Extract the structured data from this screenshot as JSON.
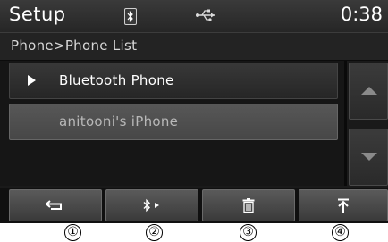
{
  "status": {
    "title": "Setup",
    "clock": "0:38"
  },
  "breadcrumb": "Phone>Phone List",
  "list": {
    "items": [
      {
        "label": "Bluetooth Phone"
      },
      {
        "label": "anitooni's iPhone"
      }
    ]
  },
  "toolbar": {
    "buttons": [
      {
        "icon": "back-arrow-icon"
      },
      {
        "icon": "bluetooth-connect-icon"
      },
      {
        "icon": "trash-icon"
      },
      {
        "icon": "top-arrow-icon"
      }
    ]
  },
  "callouts": [
    "①",
    "②",
    "③",
    "④"
  ],
  "colors": {
    "bar": "#2f2f2f",
    "selected_row": "#4f4f4f",
    "text": "#ffffff"
  }
}
